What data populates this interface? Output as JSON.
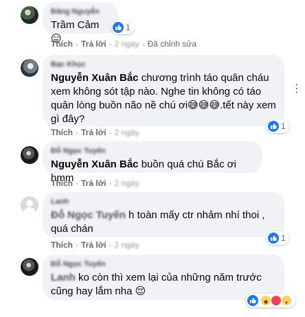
{
  "comments": [
    {
      "author": "Đăng Nguyễn",
      "mention": "",
      "text": "Trầm Cảm 😑",
      "actions": {
        "like": "Thích",
        "reply": "Trả lời",
        "time": "2 ngày",
        "edited": "Đã chỉnh sửa"
      },
      "reaction_count": "1",
      "reactions": [
        "like"
      ]
    },
    {
      "author": "Bạc Khọc",
      "mention": "Nguyễn Xuân Bắc",
      "text": " chương trình táo quân cháu xem không sót tập nào. Nghe tin không có táo quân lòng buồn não nề chú ơi😅😅😅.tết này xem gì đây?",
      "actions": {
        "like": "Thích",
        "reply": "Trả lời",
        "time": "2 ngày"
      },
      "reaction_count": "1",
      "reactions": [
        "like"
      ]
    },
    {
      "author": "Đỗ Ngọc Tuyến",
      "mention": "Nguyễn Xuân Bắc",
      "text": " buồn quá chú Bắc ơi hmm",
      "actions": {
        "like": "Thích",
        "reply": "Trả lời",
        "time": "2 ngày"
      },
      "reaction_count": "",
      "reactions": []
    },
    {
      "author": "Lanh",
      "mention": "Đỗ Ngọc Tuyến",
      "text": " h toàn mấy ctr nhảm nhí thoi , quá chán",
      "actions": {
        "like": "Thích",
        "reply": "Trả lời",
        "time": "2 ngày"
      },
      "reaction_count": "1",
      "reactions": [
        "like"
      ]
    },
    {
      "author": "Đỗ Ngọc Tuyến",
      "mention": "Lanh",
      "text": " ko còn thì xem lại của những năm trước cũng hay lắm nha 😌",
      "actions": {},
      "reaction_count": "",
      "reactions": [
        "like",
        "haha",
        "love",
        "sad"
      ]
    }
  ],
  "icons": {
    "more": "more-options-icon",
    "like": "like-icon"
  },
  "colors": {
    "bubble": "#f0f2f5",
    "like_blue": "#1877f2",
    "meta_gray": "#65676b"
  }
}
